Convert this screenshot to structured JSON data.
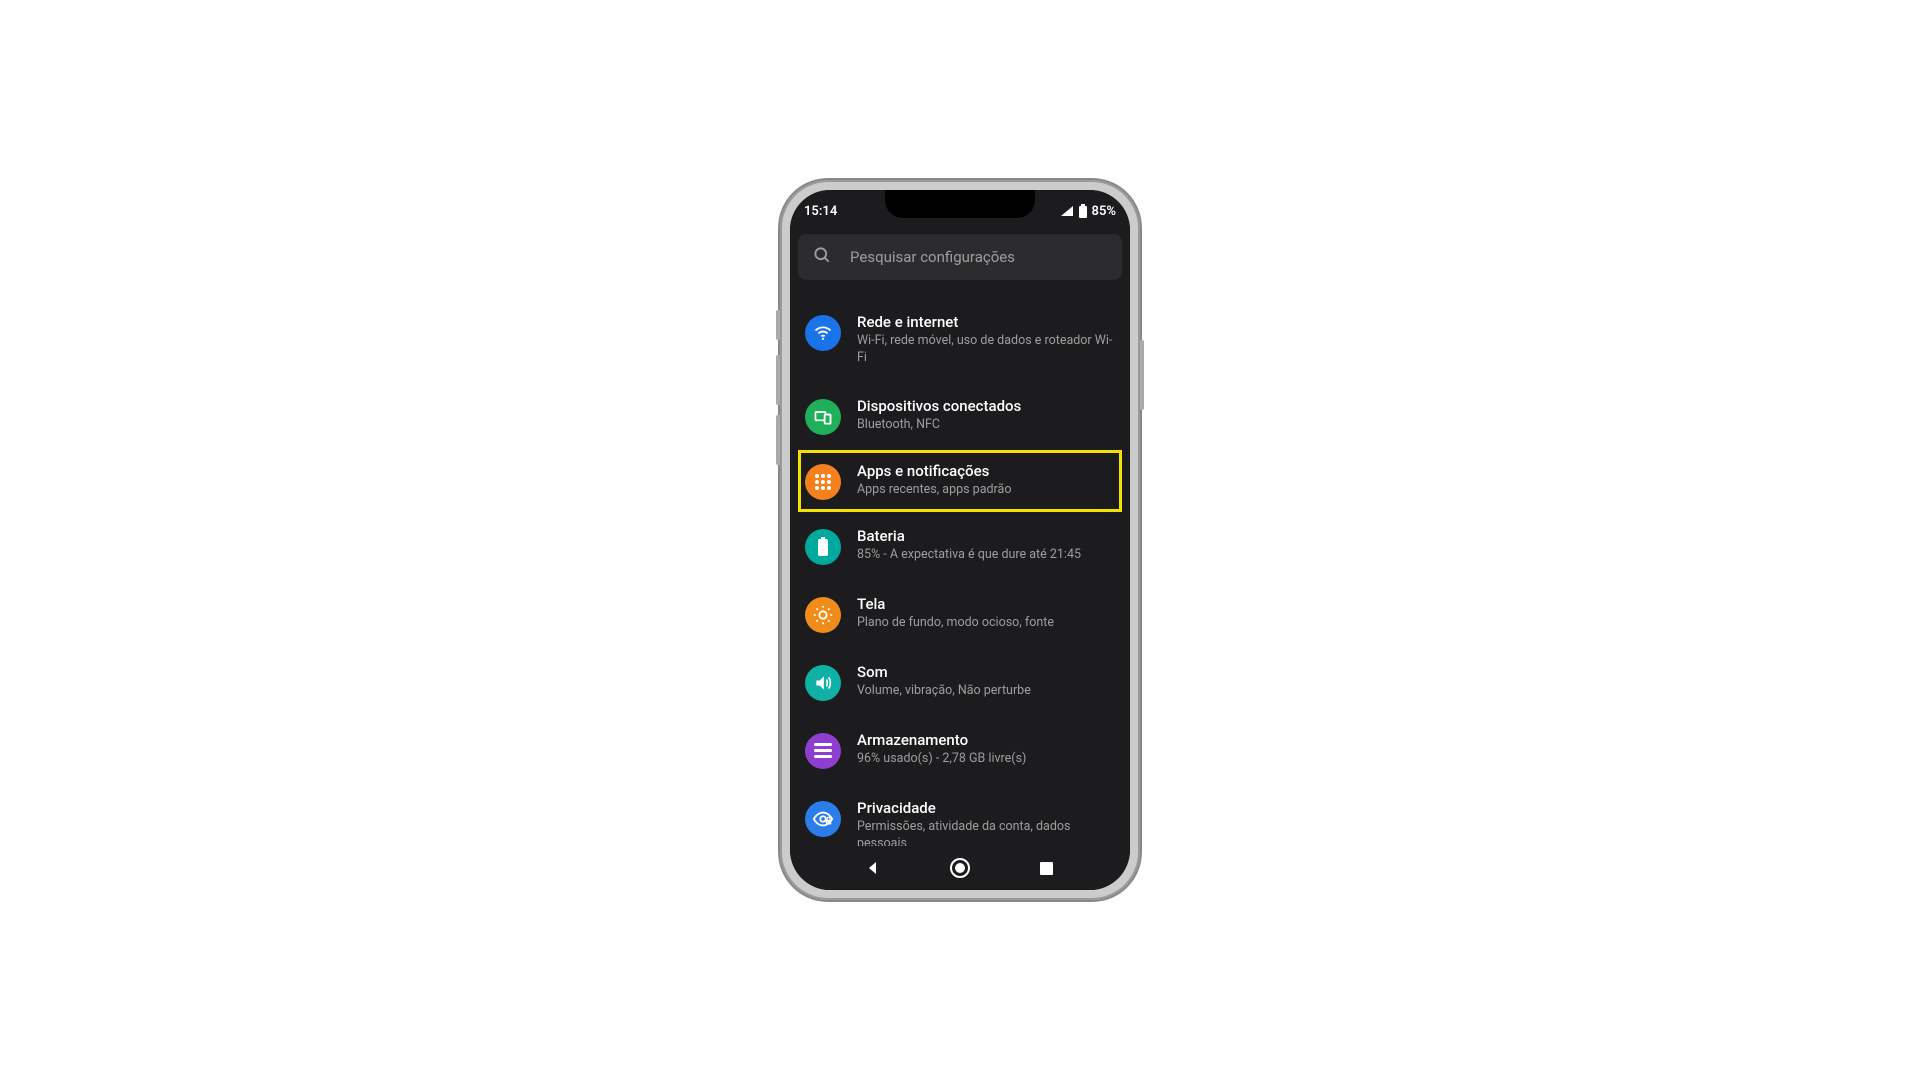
{
  "status_bar": {
    "time": "15:14",
    "battery_percent": "85%"
  },
  "search": {
    "placeholder": "Pesquisar configurações"
  },
  "settings": {
    "items": [
      {
        "id": "network",
        "icon": "wifi-icon",
        "color": "bg-blue",
        "title": "Rede e internet",
        "subtitle": "Wi-Fi, rede móvel, uso de dados e roteador Wi-Fi",
        "highlighted": false
      },
      {
        "id": "connected",
        "icon": "devices-icon",
        "color": "bg-green",
        "title": "Dispositivos conectados",
        "subtitle": "Bluetooth, NFC",
        "highlighted": false
      },
      {
        "id": "apps",
        "icon": "apps-icon",
        "color": "bg-orange",
        "title": "Apps e notificações",
        "subtitle": "Apps recentes, apps padrão",
        "highlighted": true
      },
      {
        "id": "battery",
        "icon": "battery-icon",
        "color": "bg-teal",
        "title": "Bateria",
        "subtitle": "85% - A expectativa é que dure até 21:45",
        "highlighted": false
      },
      {
        "id": "display",
        "icon": "display-icon",
        "color": "bg-orange2",
        "title": "Tela",
        "subtitle": "Plano de fundo, modo ocioso, fonte",
        "highlighted": false
      },
      {
        "id": "sound",
        "icon": "sound-icon",
        "color": "bg-teal2",
        "title": "Som",
        "subtitle": "Volume, vibração, Não perturbe",
        "highlighted": false
      },
      {
        "id": "storage",
        "icon": "storage-icon",
        "color": "bg-purple",
        "title": "Armazenamento",
        "subtitle": "96% usado(s) - 2,78 GB livre(s)",
        "highlighted": false
      },
      {
        "id": "privacy",
        "icon": "privacy-icon",
        "color": "bg-blue2",
        "title": "Privacidade",
        "subtitle": "Permissões, atividade da conta, dados pessoais",
        "highlighted": false
      }
    ]
  },
  "highlight_color": "#f5e100"
}
